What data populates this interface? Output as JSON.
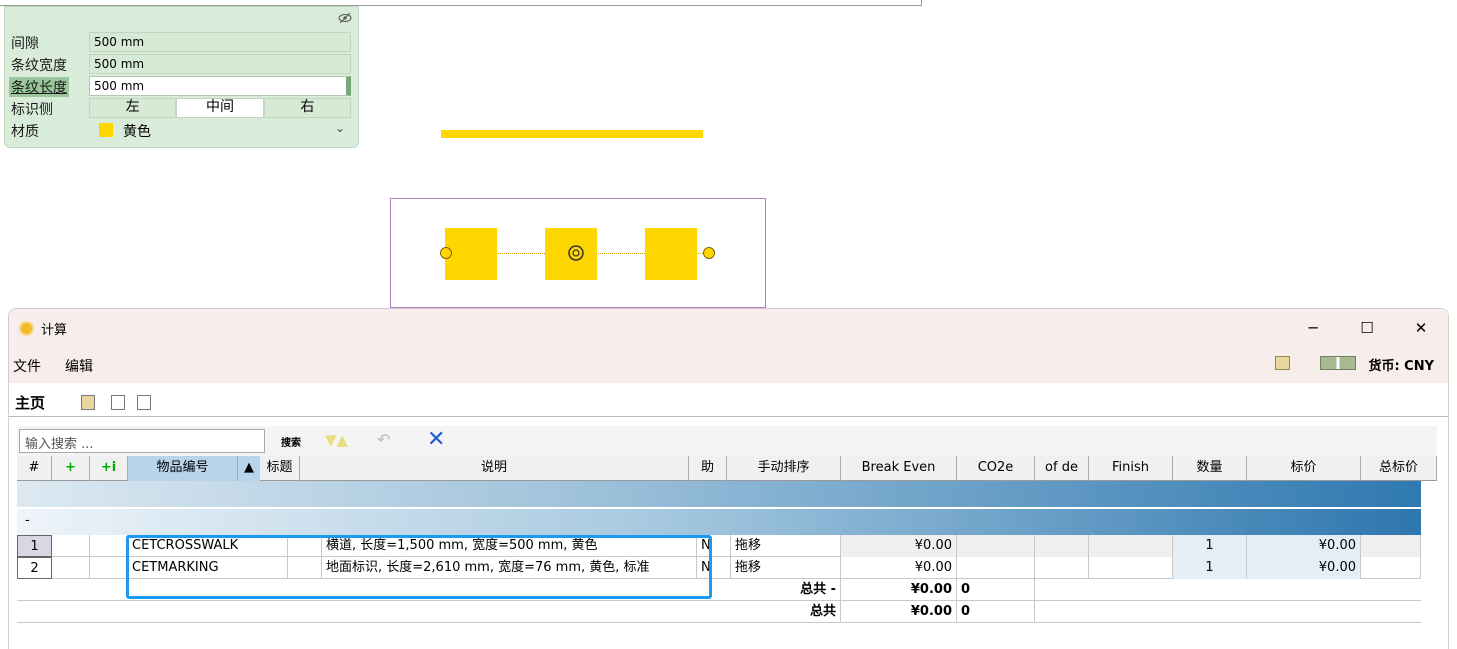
{
  "properties": {
    "rows": [
      {
        "label": "间隙",
        "value": "500 mm"
      },
      {
        "label": "条纹宽度",
        "value": "500 mm"
      },
      {
        "label": "条纹长度",
        "value": "500 mm"
      }
    ],
    "side_label": "标识侧",
    "side_options": [
      "左",
      "中间",
      "右"
    ],
    "material_label": "材质",
    "material_value": "黄色",
    "material_color": "#ffd700"
  },
  "window": {
    "title": "计算",
    "controls": {
      "minimize": "─",
      "maximize": "☐",
      "close": "✕"
    },
    "menu": [
      "文件",
      "编辑"
    ],
    "currency": "货币: CNY",
    "tab_main": "主页",
    "search_placeholder": "输入搜索 ...",
    "search_button": "搜索"
  },
  "table": {
    "headers": [
      "#",
      "+",
      "+i",
      "物品编号",
      "▲",
      "标题",
      "说明",
      "助",
      "手动排序",
      "Break Even",
      "CO2e",
      "of de",
      "Finish",
      "数量",
      "标价",
      "总标价"
    ],
    "sort_marker": "-",
    "group_dash": "-",
    "rows": [
      {
        "idx": "1",
        "id": "CETCROSSWALK",
        "desc": "横道, 长度=1,500 mm, 宽度=500 mm, 黄色",
        "flag": "N",
        "sort": "拖移",
        "break_even": "¥0.00",
        "qty": "1",
        "price": "¥0.00"
      },
      {
        "idx": "2",
        "id": "CETMARKING",
        "desc": "地面标识, 长度=2,610 mm, 宽度=76 mm, 黄色, 标准",
        "flag": "N",
        "sort": "拖移",
        "break_even": "¥0.00",
        "qty": "1",
        "price": "¥0.00"
      }
    ],
    "totals": [
      {
        "label": "总共 -",
        "value": "¥0.00",
        "co2": "0"
      },
      {
        "label": "总共",
        "value": "¥0.00",
        "co2": "0"
      }
    ]
  }
}
